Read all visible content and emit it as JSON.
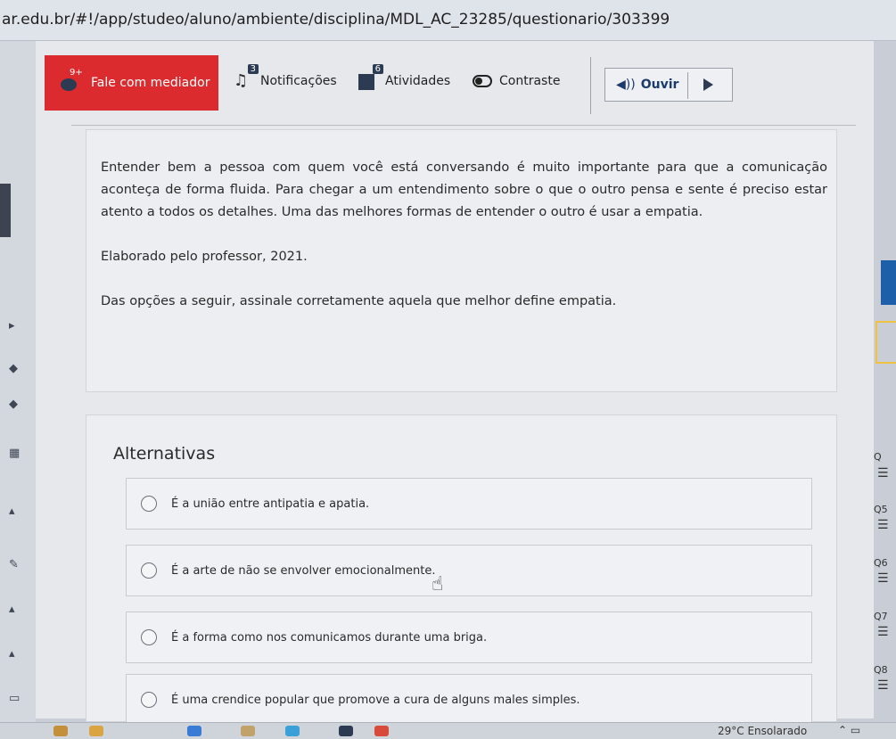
{
  "browser": {
    "url": "ar.edu.br/#!/app/studeo/aluno/ambiente/disciplina/MDL_AC_23285/questionario/303399"
  },
  "topbar": {
    "mediador_label": "Fale com mediador",
    "mediador_badge": "9+",
    "notificacoes_label": "Notificações",
    "notificacoes_count": "3",
    "atividades_label": "Atividades",
    "atividades_count": "6",
    "contraste_label": "Contraste",
    "ouvir_label": "Ouvir"
  },
  "question": {
    "paragraph1": "Entender bem a pessoa com quem você está conversando é muito importante para que a comunicação aconteça de forma fluida. Para chegar a um entendimento sobre o que o outro pensa e sente é preciso estar atento a todos os detalhes. Uma das melhores formas de entender o outro é usar a empatia.",
    "source": "Elaborado pelo professor, 2021.",
    "prompt": "Das opções a seguir, assinale corretamente aquela que melhor define empatia."
  },
  "alternatives": {
    "title": "Alternativas",
    "options": [
      "É a união entre antipatia e apatia.",
      "É a arte de não se envolver emocionalmente.",
      "É a forma como nos comunicamos durante uma briga.",
      "É uma crendice popular que promove a cura de alguns males simples."
    ]
  },
  "question_nav": {
    "items": [
      "Q",
      "Q5",
      "Q6",
      "Q7",
      "Q8"
    ]
  },
  "taskbar": {
    "weather": "29°C  Ensolarado"
  },
  "colors": {
    "mediador_bg": "#dc2b2f",
    "accent_dark": "#2c3a52",
    "active_blue": "#1d5fa8",
    "highlight_yellow": "#f0c242"
  }
}
